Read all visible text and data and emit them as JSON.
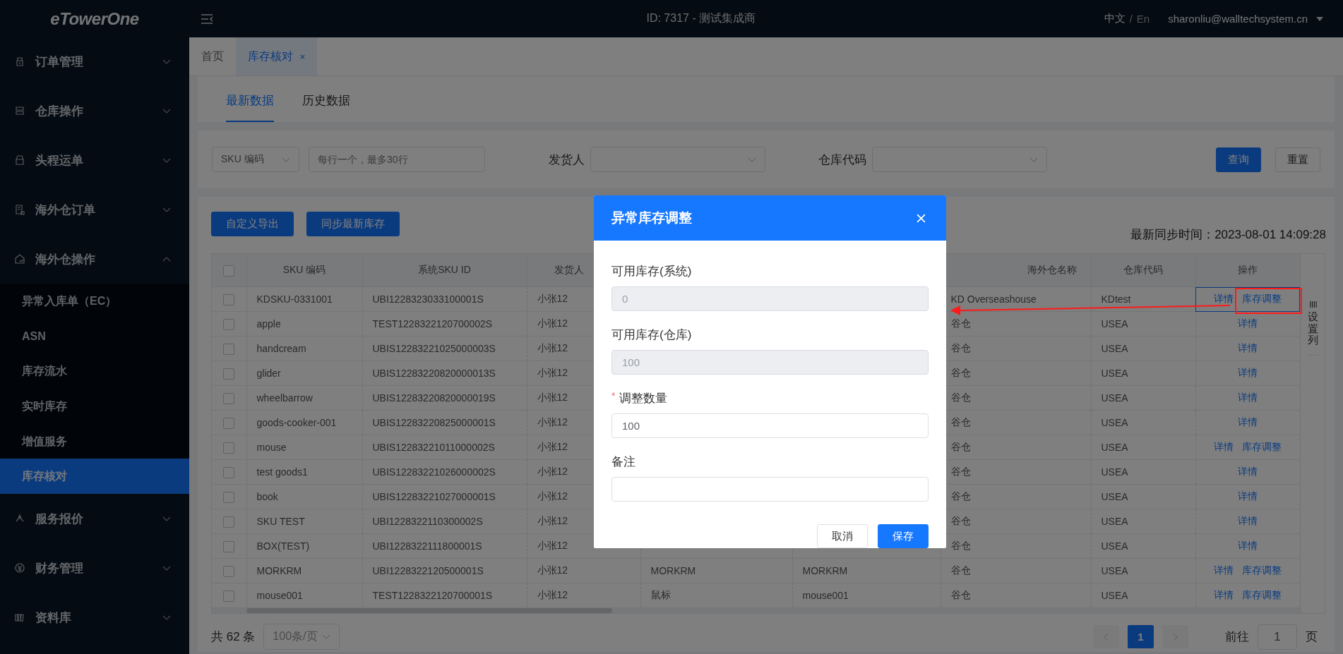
{
  "header": {
    "logo": "eTowerOne",
    "title": "ID: 7317 - 测试集成商",
    "languages": [
      {
        "label": "中文",
        "selected": true
      },
      {
        "label": "En",
        "selected": false
      }
    ],
    "language_separator": "/",
    "user": "sharonliu@walltechsystem.cn"
  },
  "sidebar": {
    "items": [
      {
        "label": "订单管理",
        "expanded": false
      },
      {
        "label": "仓库操作",
        "expanded": false
      },
      {
        "label": "头程运单",
        "expanded": false
      },
      {
        "label": "海外仓订单",
        "expanded": false
      },
      {
        "label": "海外仓操作",
        "expanded": true,
        "children": [
          {
            "label": "异常入库单（EC）",
            "selected": false
          },
          {
            "label": "ASN",
            "selected": false
          },
          {
            "label": "库存流水",
            "selected": false
          },
          {
            "label": "实时库存",
            "selected": false
          },
          {
            "label": "增值服务",
            "selected": false
          },
          {
            "label": "库存核对",
            "selected": true
          }
        ]
      },
      {
        "label": "服务报价",
        "expanded": false
      },
      {
        "label": "财务管理",
        "expanded": false
      },
      {
        "label": "资料库",
        "expanded": false
      }
    ]
  },
  "page_tabs": [
    {
      "label": "首页",
      "selected": false,
      "closable": false
    },
    {
      "label": "库存核对",
      "selected": true,
      "closable": true
    }
  ],
  "data_tabs": [
    {
      "label": "最新数据",
      "selected": true
    },
    {
      "label": "历史数据",
      "selected": false
    }
  ],
  "filters": {
    "sku_type": "SKU 编码",
    "sku_input": {
      "placeholder": "每行一个，最多30行"
    },
    "shipper_label": "发货人",
    "warehouse_label": "仓库代码",
    "buttons": [
      {
        "label": "查询",
        "kind": "primary"
      },
      {
        "label": "重置",
        "kind": "default"
      }
    ]
  },
  "actions": [
    "自定义导出",
    "同步最新库存"
  ],
  "sync_time": "最新同步时间：2023-08-01 14:09:28",
  "table": {
    "all_checked": false,
    "columns": [
      "SKU 编码",
      "系统SKU ID",
      "发货人",
      null,
      null,
      "海外仓名称",
      "仓库代码",
      "操作"
    ],
    "settings_label": "设置列",
    "rows": [
      {
        "checked": false,
        "cells": [
          "KDSKU-0331001",
          "UBI1228323033100001S",
          "小张12",
          null,
          null,
          "KD Overseashouse",
          "KDtest"
        ],
        "actions": [
          "详情",
          "库存调整"
        ]
      },
      {
        "checked": false,
        "cells": [
          "apple",
          "TEST1228322120700002S",
          "小张12",
          null,
          null,
          "谷仓",
          "USEA"
        ],
        "actions": [
          "详情"
        ]
      },
      {
        "checked": false,
        "cells": [
          "handcream",
          "UBIS12283221025000003S",
          "小张12",
          null,
          null,
          "谷仓",
          "USEA"
        ],
        "actions": [
          "详情"
        ]
      },
      {
        "checked": false,
        "cells": [
          "glider",
          "UBIS12283220820000013S",
          "小张12",
          null,
          null,
          "谷仓",
          "USEA"
        ],
        "actions": [
          "详情"
        ]
      },
      {
        "checked": false,
        "cells": [
          "wheelbarrow",
          "UBIS12283220820000019S",
          "小张12",
          null,
          null,
          "谷仓",
          "USEA"
        ],
        "actions": [
          "详情"
        ]
      },
      {
        "checked": false,
        "cells": [
          "goods-cooker-001",
          "UBIS12283220825000001S",
          "小张12",
          null,
          null,
          "谷仓",
          "USEA"
        ],
        "actions": [
          "详情"
        ]
      },
      {
        "checked": false,
        "cells": [
          "mouse",
          "UBIS12283221011000002S",
          "小张12",
          null,
          null,
          "谷仓",
          "USEA"
        ],
        "actions": [
          "详情",
          "库存调整"
        ]
      },
      {
        "checked": false,
        "cells": [
          "test goods1",
          "UBIS12283221026000002S",
          "小张12",
          null,
          null,
          "谷仓",
          "USEA"
        ],
        "actions": [
          "详情"
        ]
      },
      {
        "checked": false,
        "cells": [
          "book",
          "UBIS12283221027000001S",
          "小张12",
          null,
          null,
          "谷仓",
          "USEA"
        ],
        "actions": [
          "详情"
        ]
      },
      {
        "checked": false,
        "cells": [
          "SKU TEST",
          "UBI1228322110300002S",
          "小张12",
          null,
          null,
          "谷仓",
          "USEA"
        ],
        "actions": [
          "详情"
        ]
      },
      {
        "checked": false,
        "cells": [
          "BOX(TEST)",
          "UBI1228322111800001S",
          "小张12",
          null,
          null,
          "谷仓",
          "USEA"
        ],
        "actions": [
          "详情"
        ]
      },
      {
        "checked": false,
        "cells": [
          "MORKRM",
          "UBI1228322120500001S",
          "小张12",
          "MORKRM",
          "MORKRM",
          "谷仓",
          "USEA"
        ],
        "actions": [
          "详情",
          "库存调整"
        ]
      },
      {
        "checked": false,
        "cells": [
          "mouse001",
          "TEST1228322120700001S",
          "小张12",
          "鼠标",
          "mouse001",
          "谷仓",
          "USEA"
        ],
        "actions": [
          "详情",
          "库存调整"
        ]
      }
    ]
  },
  "pagination": {
    "total": "共 62 条",
    "page_size": "100条/页",
    "pages": [
      {
        "label": "1",
        "selected": true
      }
    ],
    "goto_label": "前往",
    "goto_value": "1",
    "goto_suffix": "页"
  },
  "dialog": {
    "title": "异常库存调整",
    "fields": [
      {
        "label": "可用库存(系统)",
        "value": "0",
        "disabled": true
      },
      {
        "label": "可用库存(仓库)",
        "value": "100",
        "disabled": true
      },
      {
        "label": "调整数量",
        "required_mark": "*",
        "value": "100",
        "disabled": false
      },
      {
        "label": "备注",
        "disabled": false
      }
    ],
    "buttons": [
      {
        "label": "取消",
        "kind": "default"
      },
      {
        "label": "保存",
        "kind": "primary"
      }
    ]
  }
}
